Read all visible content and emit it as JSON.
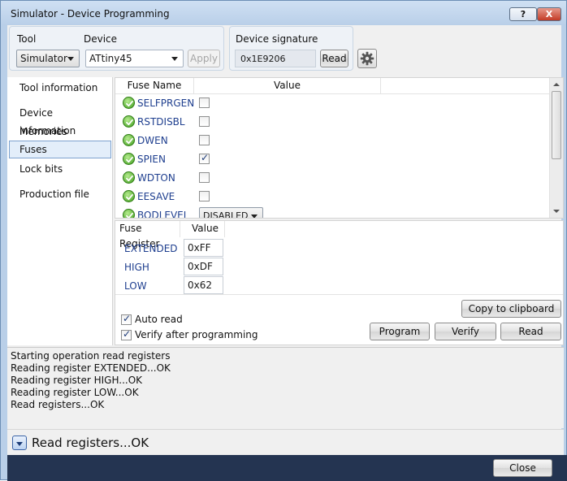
{
  "window": {
    "title": "Simulator - Device Programming",
    "help_label": "?",
    "close_glyph": "X"
  },
  "toolbar": {
    "tool_label": "Tool",
    "tool_value": "Simulator",
    "device_label": "Device",
    "device_value": "ATtiny45",
    "apply_label": "Apply",
    "signature_label": "Device signature",
    "signature_value": "0x1E9206",
    "read_label": "Read",
    "settings_icon": "gear-icon"
  },
  "nav": {
    "items": [
      {
        "label": "Tool information",
        "selected": false
      },
      {
        "label": "Device information",
        "selected": false
      },
      {
        "label": "Memories",
        "selected": false
      },
      {
        "label": "Fuses",
        "selected": true
      },
      {
        "label": "Lock bits",
        "selected": false
      },
      {
        "label": "Production file",
        "selected": false
      }
    ]
  },
  "fuses": {
    "columns": [
      "Fuse Name",
      "Value"
    ],
    "rows": [
      {
        "name": "SELFPRGEN",
        "type": "checkbox",
        "checked": false,
        "icon": "ok-icon"
      },
      {
        "name": "RSTDISBL",
        "type": "checkbox",
        "checked": false,
        "icon": "ok-icon"
      },
      {
        "name": "DWEN",
        "type": "checkbox",
        "checked": false,
        "icon": "ok-icon"
      },
      {
        "name": "SPIEN",
        "type": "checkbox",
        "checked": true,
        "icon": "ok-icon"
      },
      {
        "name": "WDTON",
        "type": "checkbox",
        "checked": false,
        "icon": "ok-icon"
      },
      {
        "name": "EESAVE",
        "type": "checkbox",
        "checked": false,
        "icon": "ok-icon"
      },
      {
        "name": "BODLEVEL",
        "type": "dropdown",
        "value": "DISABLED",
        "icon": "ok-icon"
      }
    ]
  },
  "registers": {
    "columns": [
      "Fuse Register",
      "Value"
    ],
    "rows": [
      {
        "name": "EXTENDED",
        "value": "0xFF"
      },
      {
        "name": "HIGH",
        "value": "0xDF"
      },
      {
        "name": "LOW",
        "value": "0x62"
      }
    ]
  },
  "options": {
    "auto_read_label": "Auto read",
    "auto_read_checked": true,
    "verify_label": "Verify after programming",
    "verify_checked": true
  },
  "actions": {
    "copy_label": "Copy to clipboard",
    "program_label": "Program",
    "verify_label": "Verify",
    "read_label": "Read"
  },
  "log": {
    "lines": [
      "Starting operation read registers",
      "Reading register EXTENDED...OK",
      "Reading register HIGH...OK",
      "Reading register LOW...OK",
      "Read registers...OK"
    ]
  },
  "status": {
    "text": "Read registers...OK"
  },
  "footer": {
    "close_label": "Close"
  }
}
